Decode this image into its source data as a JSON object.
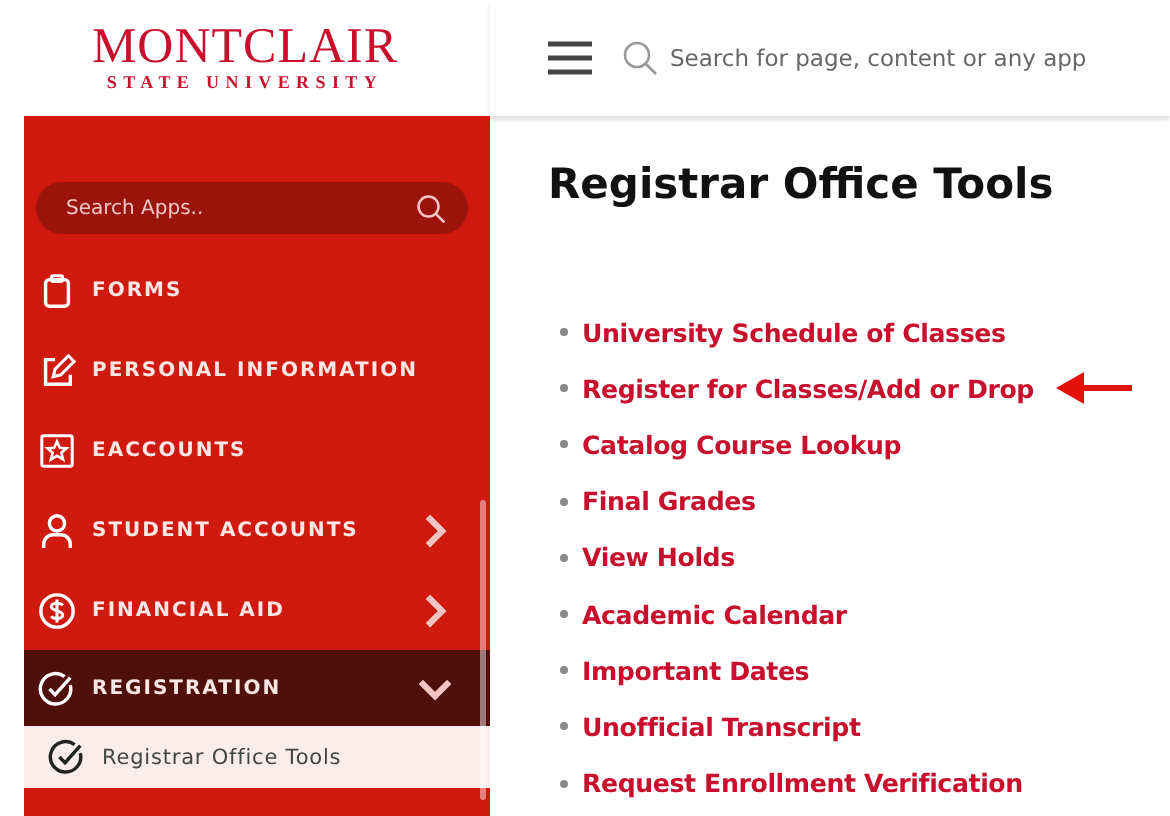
{
  "logo": {
    "name": "MONTCLAIR",
    "subtitle": "STATE UNIVERSITY"
  },
  "top_bar": {
    "search": {
      "placeholder": "Search for page, content or any app"
    }
  },
  "sidebar": {
    "search": {
      "placeholder": "Search Apps.."
    },
    "items": [
      {
        "label": "FORMS",
        "expandable": false,
        "selected": false
      },
      {
        "label": "PERSONAL INFORMATION",
        "expandable": false,
        "selected": false
      },
      {
        "label": "EACCOUNTS",
        "expandable": false,
        "selected": false
      },
      {
        "label": "STUDENT ACCOUNTS",
        "expandable": true,
        "expanded": false,
        "selected": false
      },
      {
        "label": "FINANCIAL AID",
        "expandable": true,
        "expanded": false,
        "selected": false
      },
      {
        "label": "REGISTRATION",
        "expandable": true,
        "expanded": true,
        "selected": true,
        "children": [
          {
            "label": "Registrar Office Tools",
            "selected": true
          }
        ]
      }
    ]
  },
  "main": {
    "title": "Registrar Office Tools",
    "links": [
      {
        "label": "University Schedule of Classes",
        "pointed_at": false
      },
      {
        "label": "Register for Classes/Add or Drop",
        "pointed_at": true
      },
      {
        "label": "Catalog Course Lookup",
        "pointed_at": false
      },
      {
        "label": "Final Grades",
        "pointed_at": false
      },
      {
        "label": "View Holds",
        "pointed_at": false
      },
      {
        "label": "Academic Calendar",
        "pointed_at": false
      },
      {
        "label": "Important Dates",
        "pointed_at": false
      },
      {
        "label": "Unofficial Transcript",
        "pointed_at": false
      },
      {
        "label": "Request Enrollment Verification",
        "pointed_at": false
      }
    ]
  }
}
